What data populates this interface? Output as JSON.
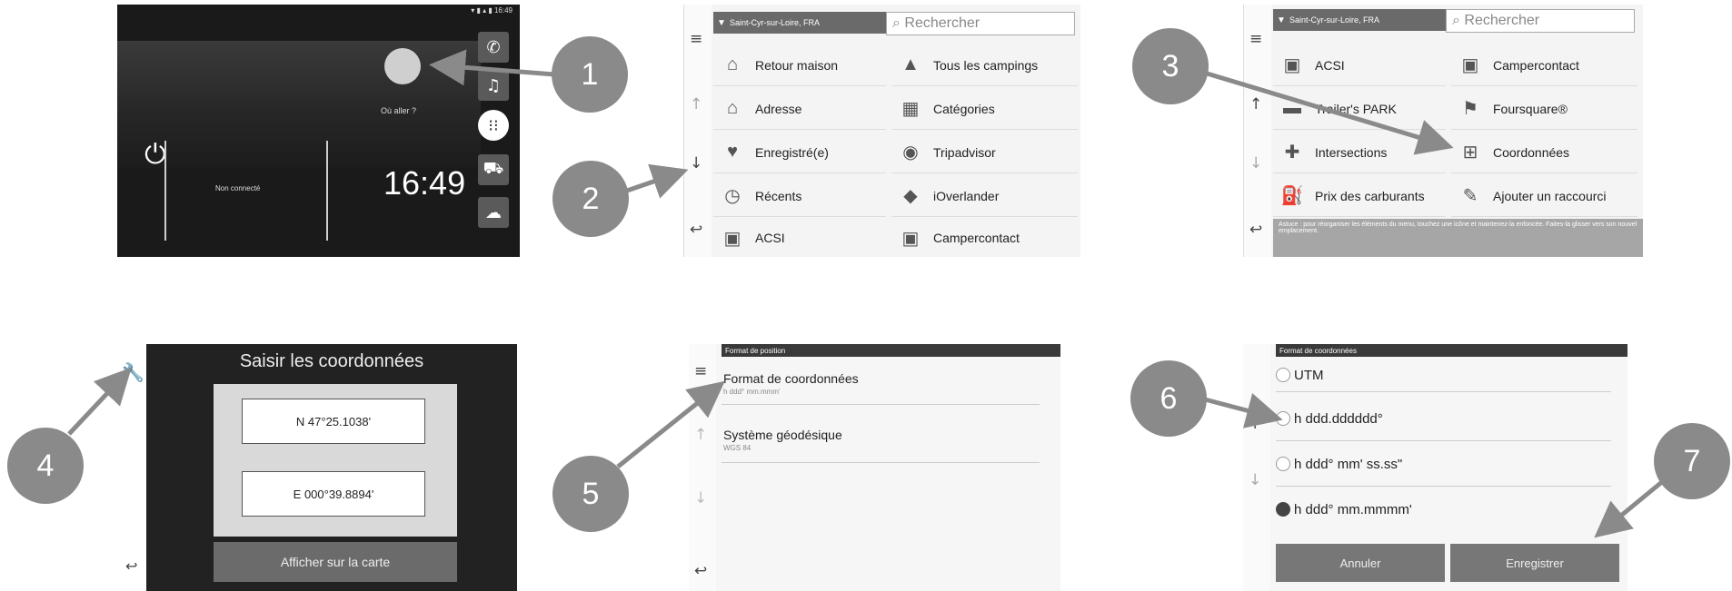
{
  "callouts": [
    "1",
    "2",
    "3",
    "4",
    "5",
    "6",
    "7"
  ],
  "home": {
    "clock": "16:49",
    "not_connected": "Non connecté",
    "where_to": "Où aller ?",
    "icons": [
      "phone-icon",
      "music-icon",
      "apps-icon",
      "car-icon",
      "weather-icon",
      "power-icon",
      "search-icon"
    ]
  },
  "where_menu": {
    "location": "Saint-Cyr-sur-Loire, FRA",
    "search_placeholder": "Rechercher",
    "items": [
      {
        "label": "Retour maison",
        "icon": "home-icon"
      },
      {
        "label": "Tous les campings",
        "icon": "camping-icon"
      },
      {
        "label": "Adresse",
        "icon": "address-icon"
      },
      {
        "label": "Catégories",
        "icon": "categories-icon"
      },
      {
        "label": "Enregistré(e)",
        "icon": "heart-icon"
      },
      {
        "label": "Tripadvisor",
        "icon": "tripadvisor-icon"
      },
      {
        "label": "Récents",
        "icon": "clock-icon"
      },
      {
        "label": "iOverlander",
        "icon": "ioverlander-icon"
      },
      {
        "label": "ACSI",
        "icon": "acsi-icon"
      },
      {
        "label": "Campercontact",
        "icon": "campercontact-icon"
      }
    ]
  },
  "where_menu_scrolled": {
    "location": "Saint-Cyr-sur-Loire, FRA",
    "search_placeholder": "Rechercher",
    "items": [
      {
        "label": "ACSI",
        "icon": "acsi-icon"
      },
      {
        "label": "Campercontact",
        "icon": "campercontact-icon"
      },
      {
        "label": "Trailer's PARK",
        "icon": "trailer-icon"
      },
      {
        "label": "Foursquare®",
        "icon": "foursquare-icon"
      },
      {
        "label": "Intersections",
        "icon": "intersection-icon"
      },
      {
        "label": "Coordonnées",
        "icon": "coordinates-icon"
      },
      {
        "label": "Prix des carburants",
        "icon": "fuel-icon"
      },
      {
        "label": "Ajouter un raccourci",
        "icon": "add-shortcut-icon"
      }
    ],
    "tip": "Astuce : pour réorganiser les éléments du menu, touchez une icône et maintenez-la enfoncée. Faites-la glisser vers son nouvel emplacement."
  },
  "coord_entry": {
    "title": "Saisir les coordonnées",
    "lat": "N 47°25.1038'",
    "lon": "E 000°39.8894'",
    "show_on_map": "Afficher sur la carte"
  },
  "position_format": {
    "header": "Format de position",
    "option1_title": "Format de coordonnées",
    "option1_value": "h ddd° mm.mmm'",
    "option2_title": "Système géodésique",
    "option2_value": "WGS 84"
  },
  "coord_format": {
    "header": "Format de coordonnées",
    "options": [
      "UTM",
      "h ddd.dddddd°",
      "h ddd° mm' ss.ss\"",
      "h ddd° mm.mmmm'"
    ],
    "selected_index": 3,
    "cancel": "Annuler",
    "save": "Enregistrer"
  }
}
